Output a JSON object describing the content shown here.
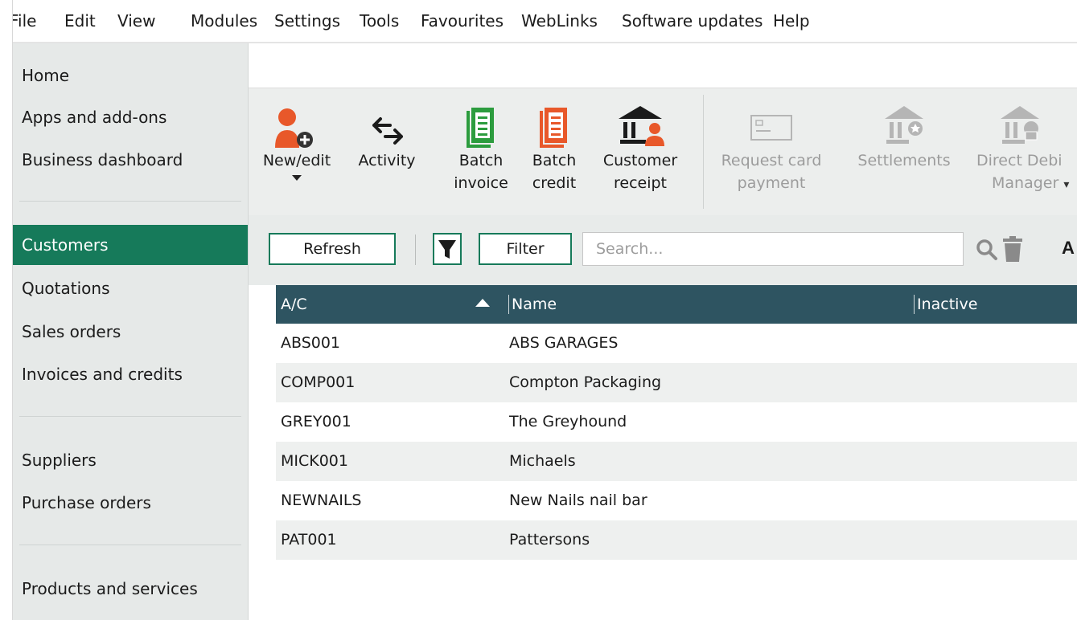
{
  "menu": [
    "File",
    "Edit",
    "View",
    "Modules",
    "Settings",
    "Tools",
    "Favourites",
    "WebLinks",
    "Software updates",
    "Help"
  ],
  "sidebar": {
    "items": [
      {
        "label": "Home"
      },
      {
        "label": "Apps and add-ons"
      },
      {
        "label": "Business dashboard"
      },
      {
        "label": "Customers",
        "active": true
      },
      {
        "label": "Quotations"
      },
      {
        "label": "Sales orders"
      },
      {
        "label": "Invoices and credits"
      },
      {
        "label": "Suppliers"
      },
      {
        "label": "Purchase orders"
      },
      {
        "label": "Products and services"
      }
    ]
  },
  "ribbon": {
    "new_edit": {
      "line1": "New/edit"
    },
    "activity": {
      "line1": "Activity"
    },
    "batch_invoice": {
      "line1": "Batch",
      "line2": "invoice"
    },
    "batch_credit": {
      "line1": "Batch",
      "line2": "credit"
    },
    "customer_receipt": {
      "line1": "Customer",
      "line2": "receipt"
    },
    "request_card": {
      "line1": "Request card",
      "line2": "payment"
    },
    "settlements": {
      "line1": "Settlements"
    },
    "direct_debit": {
      "line1": "Direct Debi",
      "line2": "Manager"
    }
  },
  "toolbar": {
    "refresh": "Refresh",
    "filter": "Filter",
    "search_placeholder": "Search...",
    "cut_label": "A"
  },
  "grid": {
    "columns": [
      "A/C",
      "Name",
      "Inactive"
    ],
    "rows": [
      {
        "ac": "ABS001",
        "name": "ABS GARAGES"
      },
      {
        "ac": "COMP001",
        "name": "Compton Packaging"
      },
      {
        "ac": "GREY001",
        "name": "The Greyhound"
      },
      {
        "ac": "MICK001",
        "name": "Michaels"
      },
      {
        "ac": "NEWNAILS",
        "name": "New Nails nail bar"
      },
      {
        "ac": "PAT001",
        "name": "Pattersons"
      }
    ]
  },
  "colors": {
    "accent": "#167a5a",
    "grid_header": "#2e5461",
    "ribbon_orange": "#e8582a",
    "ribbon_green": "#2c9c3e"
  }
}
